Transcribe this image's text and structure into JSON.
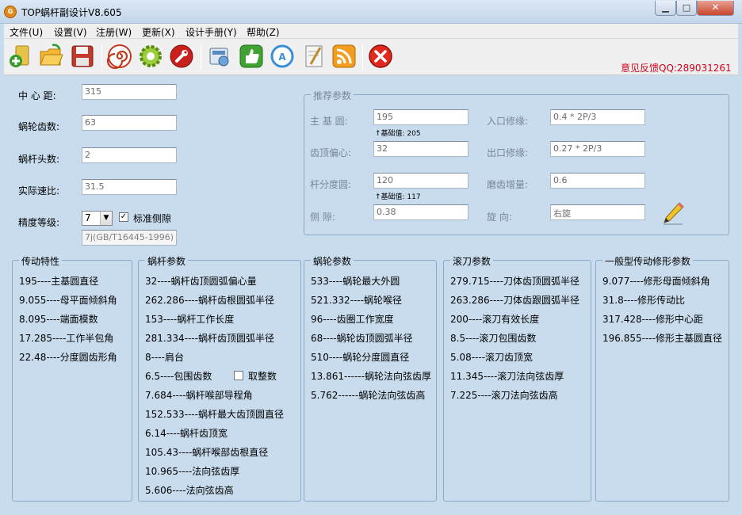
{
  "window": {
    "title": "TOP蜗杆副设计V8.605",
    "app_icon": "gear-logo-icon",
    "min_label": "▁",
    "max_label": "□",
    "close_label": "✕"
  },
  "menu": [
    "文件(U)",
    "设置(V)",
    "注册(W)",
    "更新(X)",
    "设计手册(Y)",
    "帮助(Z)"
  ],
  "toolbar": {
    "icons": [
      "add-document-icon",
      "open-folder-icon",
      "save-disk-icon",
      "spiral-icon",
      "gear-settings-icon",
      "wrench-icon",
      "calculator-icon",
      "thumbs-up-icon",
      "logo-badge-icon",
      "notepad-pen-icon",
      "rss-feed-icon",
      "close-circle-icon"
    ],
    "feedback": "意见反馈QQ:289031261"
  },
  "inputs": {
    "center_distance": {
      "label": "中  心  距:",
      "value": "315"
    },
    "gear_teeth": {
      "label": "蜗轮齿数:",
      "value": "63"
    },
    "worm_starts": {
      "label": "蜗杆头数:",
      "value": "2"
    },
    "actual_ratio": {
      "label": "实际速比:",
      "value": "31.5"
    },
    "precision": {
      "label": "精度等级:",
      "value": "7",
      "standard_label": "标准侧隙",
      "standard_checked": true,
      "standard_text": "7j(GB/T16445-1996)"
    }
  },
  "recommended": {
    "title": "推荐参数",
    "main_base_circle": {
      "label": "主  基  圆:",
      "value": "195",
      "hint": "↑基础值: 205"
    },
    "tip_offset": {
      "label": "齿顶偏心:",
      "value": "32"
    },
    "rod_pitch_circle": {
      "label": "杆分度圆:",
      "value": "120",
      "hint": "↑基础值: 117"
    },
    "side_clearance": {
      "label": "侧       隙:",
      "value": "0.38"
    },
    "entry_mod": {
      "label": "入口修缘:",
      "value": "0.4 * 2P/3"
    },
    "exit_mod": {
      "label": "出口修缘:",
      "value": "0.27 * 2P/3"
    },
    "grind_increase": {
      "label": "磨齿增量:",
      "value": "0.6"
    },
    "rotation": {
      "label": "旋       向:",
      "value": "右旋"
    }
  },
  "groups": {
    "transmission": {
      "title": "传动特性",
      "items": [
        "195----主基圆直径",
        "9.055----母平面倾斜角",
        "8.095----端面模数",
        "17.285----工作半包角",
        "22.48----分度圆齿形角"
      ]
    },
    "worm": {
      "title": "蜗杆参数",
      "items": [
        "32----蜗杆齿顶圆弧偏心量",
        "262.286----蜗杆齿根圆弧半径",
        "153----蜗杆工作长度",
        "281.334----蜗杆齿顶圆弧半径",
        "8----肩台",
        "6.5----包围齿数",
        "7.684----蜗杆喉部导程角",
        "152.533----蜗杆最大齿顶圆直径",
        "6.14----蜗杆齿顶宽",
        "105.43----蜗杆喉部齿根直径",
        "10.965----法向弦齿厚",
        "5.606----法向弦齿高"
      ],
      "round_label": "取整数"
    },
    "wheel": {
      "title": "蜗轮参数",
      "items": [
        "533----蜗轮最大外圆",
        "521.332----蜗轮喉径",
        "96----齿圈工作宽度",
        "68----蜗轮齿顶圆弧半径",
        "510----蜗轮分度圆直径",
        "13.861------蜗轮法向弦齿厚",
        "5.762------蜗轮法向弦齿高"
      ]
    },
    "hob": {
      "title": "滚刀参数",
      "items": [
        "279.715----刀体齿顶圆弧半径",
        "263.286----刀体齿跟圆弧半径",
        "200----滚刀有效长度",
        "8.5----滚刀包围齿数",
        "5.08----滚刀齿顶宽",
        "11.345----滚刀法向弦齿厚",
        "7.225----滚刀法向弦齿高"
      ]
    },
    "modification": {
      "title": "一般型传动修形参数",
      "items": [
        "9.077----修形母面倾斜角",
        "31.8----修形传动比",
        "317.428----修形中心距",
        "196.855----修形主基圆直径"
      ]
    }
  }
}
